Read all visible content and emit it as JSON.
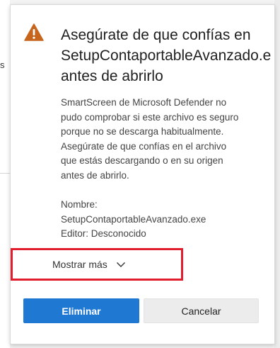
{
  "background": {
    "fragment_text": "s"
  },
  "dialog": {
    "icon": "warning-triangle-icon",
    "title_lines": [
      "Asegúrate de que confías en",
      "SetupContaportableAvanzado.e",
      "antes de abrirlo"
    ],
    "description_lines": [
      "SmartScreen de Microsoft Defender no",
      "pudo comprobar si este archivo es seguro",
      "porque no se descarga habitualmente.",
      "Asegúrate de que confías en el archivo",
      "que estás descargando o en su origen",
      "antes de abrirlo."
    ],
    "meta_lines": [
      "Nombre:",
      "SetupContaportableAvanzado.exe",
      "Editor: Desconocido"
    ],
    "show_more_label": "Mostrar más",
    "buttons": {
      "delete": "Eliminar",
      "cancel": "Cancelar"
    },
    "colors": {
      "primary": "#1f78d1",
      "highlight": "#e11d2e",
      "warning": "#c7651d"
    }
  }
}
